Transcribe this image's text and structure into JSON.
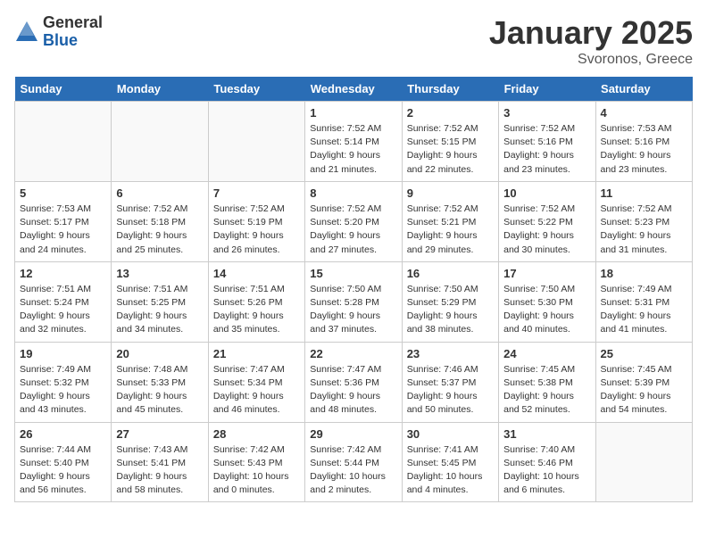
{
  "header": {
    "logo_general": "General",
    "logo_blue": "Blue",
    "month_title": "January 2025",
    "location": "Svoronos, Greece"
  },
  "weekdays": [
    "Sunday",
    "Monday",
    "Tuesday",
    "Wednesday",
    "Thursday",
    "Friday",
    "Saturday"
  ],
  "weeks": [
    {
      "days": [
        {
          "num": "",
          "content": "",
          "empty": true
        },
        {
          "num": "",
          "content": "",
          "empty": true
        },
        {
          "num": "",
          "content": "",
          "empty": true
        },
        {
          "num": "1",
          "content": "Sunrise: 7:52 AM\nSunset: 5:14 PM\nDaylight: 9 hours and 21 minutes.",
          "empty": false
        },
        {
          "num": "2",
          "content": "Sunrise: 7:52 AM\nSunset: 5:15 PM\nDaylight: 9 hours and 22 minutes.",
          "empty": false
        },
        {
          "num": "3",
          "content": "Sunrise: 7:52 AM\nSunset: 5:16 PM\nDaylight: 9 hours and 23 minutes.",
          "empty": false
        },
        {
          "num": "4",
          "content": "Sunrise: 7:53 AM\nSunset: 5:16 PM\nDaylight: 9 hours and 23 minutes.",
          "empty": false
        }
      ]
    },
    {
      "days": [
        {
          "num": "5",
          "content": "Sunrise: 7:53 AM\nSunset: 5:17 PM\nDaylight: 9 hours and 24 minutes.",
          "empty": false
        },
        {
          "num": "6",
          "content": "Sunrise: 7:52 AM\nSunset: 5:18 PM\nDaylight: 9 hours and 25 minutes.",
          "empty": false
        },
        {
          "num": "7",
          "content": "Sunrise: 7:52 AM\nSunset: 5:19 PM\nDaylight: 9 hours and 26 minutes.",
          "empty": false
        },
        {
          "num": "8",
          "content": "Sunrise: 7:52 AM\nSunset: 5:20 PM\nDaylight: 9 hours and 27 minutes.",
          "empty": false
        },
        {
          "num": "9",
          "content": "Sunrise: 7:52 AM\nSunset: 5:21 PM\nDaylight: 9 hours and 29 minutes.",
          "empty": false
        },
        {
          "num": "10",
          "content": "Sunrise: 7:52 AM\nSunset: 5:22 PM\nDaylight: 9 hours and 30 minutes.",
          "empty": false
        },
        {
          "num": "11",
          "content": "Sunrise: 7:52 AM\nSunset: 5:23 PM\nDaylight: 9 hours and 31 minutes.",
          "empty": false
        }
      ]
    },
    {
      "days": [
        {
          "num": "12",
          "content": "Sunrise: 7:51 AM\nSunset: 5:24 PM\nDaylight: 9 hours and 32 minutes.",
          "empty": false
        },
        {
          "num": "13",
          "content": "Sunrise: 7:51 AM\nSunset: 5:25 PM\nDaylight: 9 hours and 34 minutes.",
          "empty": false
        },
        {
          "num": "14",
          "content": "Sunrise: 7:51 AM\nSunset: 5:26 PM\nDaylight: 9 hours and 35 minutes.",
          "empty": false
        },
        {
          "num": "15",
          "content": "Sunrise: 7:50 AM\nSunset: 5:28 PM\nDaylight: 9 hours and 37 minutes.",
          "empty": false
        },
        {
          "num": "16",
          "content": "Sunrise: 7:50 AM\nSunset: 5:29 PM\nDaylight: 9 hours and 38 minutes.",
          "empty": false
        },
        {
          "num": "17",
          "content": "Sunrise: 7:50 AM\nSunset: 5:30 PM\nDaylight: 9 hours and 40 minutes.",
          "empty": false
        },
        {
          "num": "18",
          "content": "Sunrise: 7:49 AM\nSunset: 5:31 PM\nDaylight: 9 hours and 41 minutes.",
          "empty": false
        }
      ]
    },
    {
      "days": [
        {
          "num": "19",
          "content": "Sunrise: 7:49 AM\nSunset: 5:32 PM\nDaylight: 9 hours and 43 minutes.",
          "empty": false
        },
        {
          "num": "20",
          "content": "Sunrise: 7:48 AM\nSunset: 5:33 PM\nDaylight: 9 hours and 45 minutes.",
          "empty": false
        },
        {
          "num": "21",
          "content": "Sunrise: 7:47 AM\nSunset: 5:34 PM\nDaylight: 9 hours and 46 minutes.",
          "empty": false
        },
        {
          "num": "22",
          "content": "Sunrise: 7:47 AM\nSunset: 5:36 PM\nDaylight: 9 hours and 48 minutes.",
          "empty": false
        },
        {
          "num": "23",
          "content": "Sunrise: 7:46 AM\nSunset: 5:37 PM\nDaylight: 9 hours and 50 minutes.",
          "empty": false
        },
        {
          "num": "24",
          "content": "Sunrise: 7:45 AM\nSunset: 5:38 PM\nDaylight: 9 hours and 52 minutes.",
          "empty": false
        },
        {
          "num": "25",
          "content": "Sunrise: 7:45 AM\nSunset: 5:39 PM\nDaylight: 9 hours and 54 minutes.",
          "empty": false
        }
      ]
    },
    {
      "days": [
        {
          "num": "26",
          "content": "Sunrise: 7:44 AM\nSunset: 5:40 PM\nDaylight: 9 hours and 56 minutes.",
          "empty": false
        },
        {
          "num": "27",
          "content": "Sunrise: 7:43 AM\nSunset: 5:41 PM\nDaylight: 9 hours and 58 minutes.",
          "empty": false
        },
        {
          "num": "28",
          "content": "Sunrise: 7:42 AM\nSunset: 5:43 PM\nDaylight: 10 hours and 0 minutes.",
          "empty": false
        },
        {
          "num": "29",
          "content": "Sunrise: 7:42 AM\nSunset: 5:44 PM\nDaylight: 10 hours and 2 minutes.",
          "empty": false
        },
        {
          "num": "30",
          "content": "Sunrise: 7:41 AM\nSunset: 5:45 PM\nDaylight: 10 hours and 4 minutes.",
          "empty": false
        },
        {
          "num": "31",
          "content": "Sunrise: 7:40 AM\nSunset: 5:46 PM\nDaylight: 10 hours and 6 minutes.",
          "empty": false
        },
        {
          "num": "",
          "content": "",
          "empty": true
        }
      ]
    }
  ]
}
